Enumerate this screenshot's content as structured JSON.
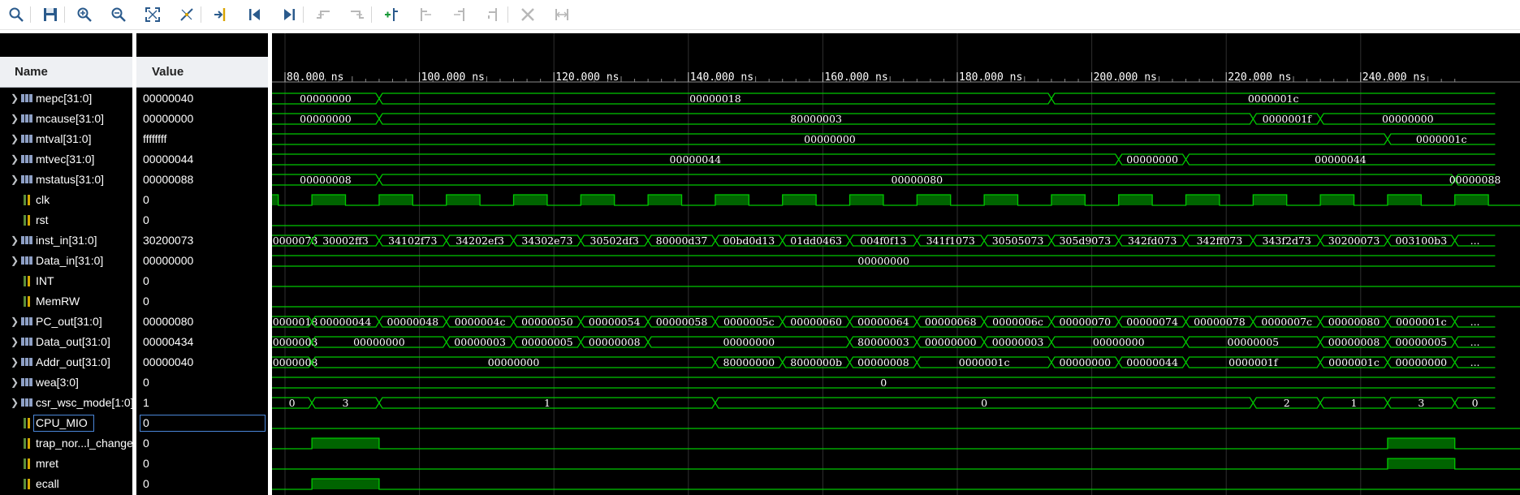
{
  "toolbar": {
    "buttons": [
      {
        "name": "search-button",
        "icon": "search-icon"
      },
      {
        "name": "save-button",
        "icon": "save-icon"
      },
      {
        "name": "zoom-in-button",
        "icon": "zoom-in-icon"
      },
      {
        "name": "zoom-out-button",
        "icon": "zoom-out-icon"
      },
      {
        "name": "zoom-fit-button",
        "icon": "zoom-fit-icon"
      },
      {
        "name": "cursor-button",
        "icon": "cursor-icon"
      },
      {
        "name": "go-to-cursor-button",
        "icon": "go-to-cursor-icon"
      },
      {
        "name": "go-to-time-zero-button",
        "icon": "go-to-start-icon"
      },
      {
        "name": "go-to-last-time-button",
        "icon": "go-to-end-icon"
      },
      {
        "name": "previous-transition-button",
        "icon": "previous-transition-icon"
      },
      {
        "name": "next-transition-button",
        "icon": "next-transition-icon"
      },
      {
        "name": "add-marker-button",
        "icon": "add-marker-icon"
      },
      {
        "name": "previous-marker-button",
        "icon": "previous-marker-icon"
      },
      {
        "name": "next-marker-button",
        "icon": "next-marker-icon"
      },
      {
        "name": "swap-cursors-button",
        "icon": "swap-cursors-icon"
      },
      {
        "name": "delete-marker-button",
        "icon": "delete-icon"
      },
      {
        "name": "snap-button",
        "icon": "snap-icon"
      }
    ]
  },
  "columns": {
    "name": "Name",
    "value": "Value"
  },
  "selected_row": "CPU_MIO",
  "signals": [
    {
      "name": "mepc[31:0]",
      "value": "00000040",
      "kind": "bus"
    },
    {
      "name": "mcause[31:0]",
      "value": "00000000",
      "kind": "bus"
    },
    {
      "name": "mtval[31:0]",
      "value": "ffffffff",
      "kind": "bus"
    },
    {
      "name": "mtvec[31:0]",
      "value": "00000044",
      "kind": "bus"
    },
    {
      "name": "mstatus[31:0]",
      "value": "00000088",
      "kind": "bus"
    },
    {
      "name": "clk",
      "value": "0",
      "kind": "bit"
    },
    {
      "name": "rst",
      "value": "0",
      "kind": "bit"
    },
    {
      "name": "inst_in[31:0]",
      "value": "30200073",
      "kind": "bus"
    },
    {
      "name": "Data_in[31:0]",
      "value": "00000000",
      "kind": "bus"
    },
    {
      "name": "INT",
      "value": "0",
      "kind": "bit"
    },
    {
      "name": "MemRW",
      "value": "0",
      "kind": "bit"
    },
    {
      "name": "PC_out[31:0]",
      "value": "00000080",
      "kind": "bus"
    },
    {
      "name": "Data_out[31:0]",
      "value": "00000434",
      "kind": "bus"
    },
    {
      "name": "Addr_out[31:0]",
      "value": "00000040",
      "kind": "bus"
    },
    {
      "name": "wea[3:0]",
      "value": "0",
      "kind": "bus"
    },
    {
      "name": "csr_wsc_mode[1:0]",
      "value": "1",
      "kind": "bus"
    },
    {
      "name": "CPU_MIO",
      "value": "0",
      "kind": "bit"
    },
    {
      "name": "trap_nor...l_change",
      "value": "0",
      "kind": "bit"
    },
    {
      "name": "mret",
      "value": "0",
      "kind": "bit"
    },
    {
      "name": "ecall",
      "value": "0",
      "kind": "bit"
    }
  ],
  "time_axis": {
    "unit": "ns",
    "view_start": 70,
    "view_end": 255,
    "labels": [
      "80.000 ns",
      "100.000 ns",
      "120.000 ns",
      "140.000 ns",
      "160.000 ns",
      "180.000 ns",
      "200.000 ns",
      "220.000 ns",
      "240.000 ns"
    ],
    "label_times": [
      80,
      100,
      120,
      140,
      160,
      180,
      200,
      220,
      240
    ]
  },
  "colors": {
    "wave": "#00c800",
    "high_fill": "#006400",
    "grid": "#2f2f2f",
    "background": "#000000",
    "header": "#eef0f3"
  },
  "waveforms": [
    {
      "type": "bus",
      "segments": [
        [
          70,
          "00000000"
        ],
        [
          94,
          "00000018"
        ],
        [
          194,
          "0000001c"
        ]
      ]
    },
    {
      "type": "bus",
      "segments": [
        [
          70,
          "00000000"
        ],
        [
          94,
          "80000003"
        ],
        [
          224,
          "0000001f"
        ],
        [
          234,
          "00000000"
        ]
      ]
    },
    {
      "type": "bus",
      "segments": [
        [
          70,
          "00000000"
        ],
        [
          244,
          "0000001c"
        ]
      ]
    },
    {
      "type": "bus",
      "segments": [
        [
          70,
          "00000044"
        ],
        [
          204,
          "00000000"
        ],
        [
          214,
          "00000044"
        ]
      ]
    },
    {
      "type": "bus",
      "segments": [
        [
          70,
          "00000008"
        ],
        [
          94,
          "00000080"
        ],
        [
          254,
          "00000088"
        ]
      ]
    },
    {
      "type": "clock",
      "period": 10,
      "high_start": 74
    },
    {
      "type": "bit",
      "high": []
    },
    {
      "type": "bus",
      "segments": [
        [
          70,
          "..."
        ],
        [
          74,
          "00000073"
        ],
        [
          84,
          "30002ff3"
        ],
        [
          94,
          "34102f73"
        ],
        [
          104,
          "34202ef3"
        ],
        [
          114,
          "34302e73"
        ],
        [
          124,
          "30502df3"
        ],
        [
          134,
          "80000d37"
        ],
        [
          144,
          "00bd0d13"
        ],
        [
          154,
          "01dd0463"
        ],
        [
          164,
          "004f0f13"
        ],
        [
          174,
          "341f1073"
        ],
        [
          184,
          "30505073"
        ],
        [
          194,
          "305d9073"
        ],
        [
          204,
          "342fd073"
        ],
        [
          214,
          "342ff073"
        ],
        [
          224,
          "343f2d73"
        ],
        [
          234,
          "30200073"
        ],
        [
          244,
          "003100b3"
        ],
        [
          254,
          "..."
        ]
      ]
    },
    {
      "type": "bus",
      "segments": [
        [
          70,
          "00000000"
        ]
      ]
    },
    {
      "type": "bit",
      "high": []
    },
    {
      "type": "bit",
      "high": []
    },
    {
      "type": "bus",
      "segments": [
        [
          70,
          "..."
        ],
        [
          74,
          "00000018"
        ],
        [
          84,
          "00000044"
        ],
        [
          94,
          "00000048"
        ],
        [
          104,
          "0000004c"
        ],
        [
          114,
          "00000050"
        ],
        [
          124,
          "00000054"
        ],
        [
          134,
          "00000058"
        ],
        [
          144,
          "0000005c"
        ],
        [
          154,
          "00000060"
        ],
        [
          164,
          "00000064"
        ],
        [
          174,
          "00000068"
        ],
        [
          184,
          "0000006c"
        ],
        [
          194,
          "00000070"
        ],
        [
          204,
          "00000074"
        ],
        [
          214,
          "00000078"
        ],
        [
          224,
          "0000007c"
        ],
        [
          234,
          "00000080"
        ],
        [
          244,
          "0000001c"
        ],
        [
          254,
          "..."
        ]
      ]
    },
    {
      "type": "bus",
      "segments": [
        [
          70,
          "..."
        ],
        [
          74,
          "00000003"
        ],
        [
          84,
          "00000000"
        ],
        [
          104,
          "00000003"
        ],
        [
          114,
          "00000005"
        ],
        [
          124,
          "00000008"
        ],
        [
          134,
          "00000000"
        ],
        [
          164,
          "80000003"
        ],
        [
          174,
          "00000000"
        ],
        [
          184,
          "00000003"
        ],
        [
          194,
          "00000000"
        ],
        [
          214,
          "00000005"
        ],
        [
          234,
          "00000008"
        ],
        [
          244,
          "00000005"
        ],
        [
          254,
          "..."
        ]
      ]
    },
    {
      "type": "bus",
      "segments": [
        [
          70,
          "..."
        ],
        [
          74,
          "00000008"
        ],
        [
          84,
          "00000000"
        ],
        [
          144,
          "80000000"
        ],
        [
          154,
          "8000000b"
        ],
        [
          164,
          "00000008"
        ],
        [
          174,
          "0000001c"
        ],
        [
          194,
          "00000000"
        ],
        [
          204,
          "00000044"
        ],
        [
          214,
          "0000001f"
        ],
        [
          234,
          "0000001c"
        ],
        [
          244,
          "00000000"
        ],
        [
          254,
          "..."
        ]
      ]
    },
    {
      "type": "bus",
      "segments": [
        [
          70,
          "0"
        ]
      ]
    },
    {
      "type": "bus",
      "segments": [
        [
          70,
          "0"
        ],
        [
          84,
          "3"
        ],
        [
          94,
          "1"
        ],
        [
          144,
          "0"
        ],
        [
          224,
          "2"
        ],
        [
          234,
          "1"
        ],
        [
          244,
          "3"
        ],
        [
          254,
          "0"
        ]
      ]
    },
    {
      "type": "bit",
      "high": []
    },
    {
      "type": "bit",
      "high": [
        [
          84,
          94
        ],
        [
          244,
          254
        ]
      ]
    },
    {
      "type": "bit",
      "high": [
        [
          244,
          254
        ]
      ]
    },
    {
      "type": "bit",
      "high": [
        [
          84,
          94
        ]
      ]
    }
  ]
}
